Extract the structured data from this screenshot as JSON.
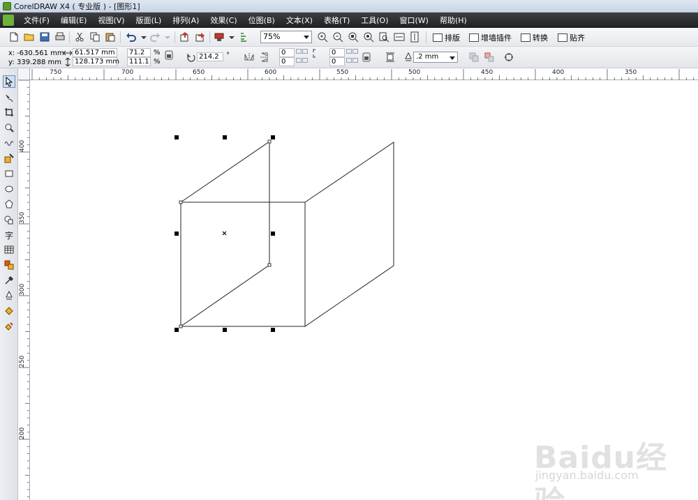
{
  "window": {
    "title": "CorelDRAW X4 ( 专业版 ) - [图形1]"
  },
  "menu": {
    "items": [
      "文件(F)",
      "编辑(E)",
      "视图(V)",
      "版面(L)",
      "排列(A)",
      "效果(C)",
      "位图(B)",
      "文本(X)",
      "表格(T)",
      "工具(O)",
      "窗口(W)",
      "帮助(H)"
    ]
  },
  "toolbar": {
    "zoom_value": "75%",
    "buttons": [
      "排版",
      "增墙插件",
      "转换",
      "贴齐"
    ]
  },
  "propbar": {
    "x_label": "x:",
    "x_value": "-630.561 mm",
    "y_label": "y:",
    "y_value": "339.288 mm",
    "width_value": "61.517 mm",
    "height_value": "128.173 mm",
    "scale_x": "71.2",
    "scale_y": "111.1",
    "pct1": "%",
    "pct2": "%",
    "rotation_value": "214.2",
    "degree": "°",
    "corner1_top": "0",
    "corner1_bottom": "0",
    "corner2_top": "0",
    "corner2_bottom": "0",
    "outline_value": ".2 mm"
  },
  "ruler_h": [
    "750",
    "700",
    "650",
    "600",
    "550",
    "500",
    "450",
    "400",
    "350"
  ],
  "ruler_v": [
    "400",
    "350",
    "300",
    "250",
    "200"
  ],
  "toolbox": {
    "icons": [
      "pick-tool",
      "shape-tool",
      "crop-tool",
      "zoom-tool",
      "freehand-tool",
      "smart-fill-tool",
      "rectangle-tool",
      "ellipse-tool",
      "polygon-tool",
      "basic-shapes-tool",
      "text-tool",
      "table-tool",
      "interactive-tool",
      "eyedropper-tool",
      "outline-tool",
      "fill-tool",
      "interactive-fill-tool"
    ],
    "text_tool_glyph": "字"
  },
  "watermark": {
    "main": "Baidu经验",
    "sub": "jingyan.baidu.com"
  }
}
